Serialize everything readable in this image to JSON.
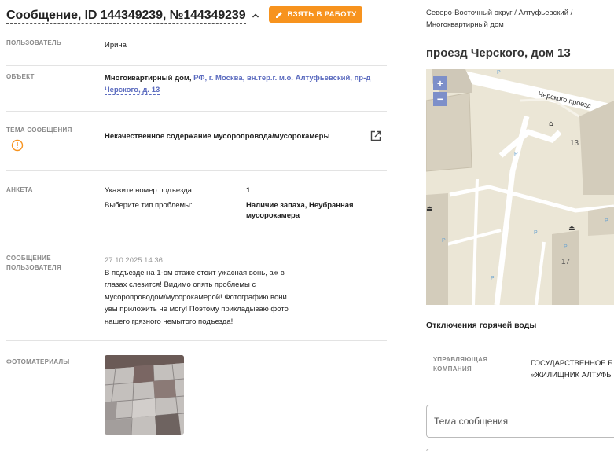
{
  "message": {
    "title": "Сообщение, ID 144349239, №144349239",
    "take_button": "ВЗЯТЬ В РАБОТУ"
  },
  "fields": {
    "user_label": "ПОЛЬЗОВАТЕЛЬ",
    "user_value": "Ирина",
    "object_label": "ОБЪЕКТ",
    "object_prefix": "Многоквартирный дом, ",
    "object_link_line1": "РФ, г. Москва, вн.тер.г. м.о. Алтуфьевский, пр-д",
    "object_link_line2": "Черского, д. 13",
    "topic_label": "ТЕМА СООБЩЕНИЯ",
    "topic_value": "Некачественное содержание мусоропровода/мусорокамеры",
    "form_label": "АНКЕТА",
    "form_q1": "Укажите номер подъезда:",
    "form_a1": "1",
    "form_q2": "Выберите тип проблемы:",
    "form_a2_line1": "Наличие запаха, Неубранная",
    "form_a2_line2": "мусорокамера",
    "usermsg_label_line1": "СООБЩЕНИЕ",
    "usermsg_label_line2": "ПОЛЬЗОВАТЕЛЯ",
    "usermsg_time": "27.10.2025 14:36",
    "usermsg_line1": "В подъезде на 1-ом этаже стоит ужасная вонь, аж в",
    "usermsg_line2": "глазах слезится! Видимо опять проблемы с",
    "usermsg_line3": "мусоропроводом/мусорокамерой! Фотографию вони",
    "usermsg_line4": "увы приложить не могу! Поэтому прикладываю фото",
    "usermsg_line5": "нашего грязного немытого подъезда!",
    "photos_label": "ФОТОМАТЕРИАЛЫ"
  },
  "right": {
    "breadcrumb_line1": "Северо-Восточный округ / Алтуфьевский /",
    "breadcrumb_line2": "Многоквартирный дом",
    "address": "проезд Черского, дом 13",
    "map_street": "Черского проезд",
    "map_building_13": "13",
    "map_building_17": "17",
    "zoom_in": "+",
    "zoom_out": "−",
    "outage_title": "Отключения горячей воды",
    "uk_label_line1": "УПРАВЛЯЮЩАЯ",
    "uk_label_line2": "КОМПАНИЯ",
    "uk_value_line1": "ГОСУДАРСТВЕННОЕ Б",
    "uk_value_line2": "«ЖИЛИЩНИК АЛТУФЬ",
    "topic_placeholder": "Тема сообщения"
  },
  "colors": {
    "accent_orange": "#f7931e",
    "link_blue": "#5b6bbf",
    "label_grey": "#8a8a8a",
    "map_zoom": "#7d8fc9"
  }
}
